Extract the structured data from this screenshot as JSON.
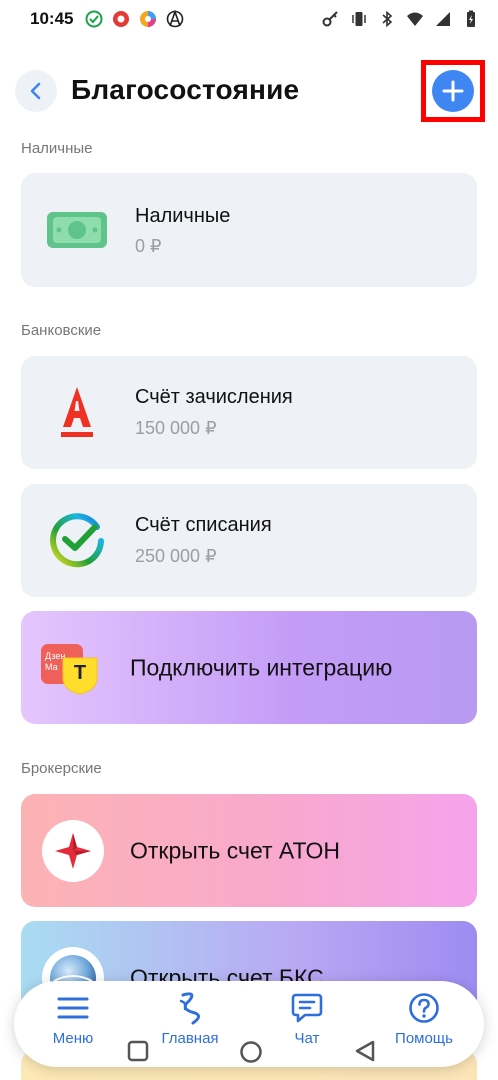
{
  "status_bar": {
    "time": "10:45",
    "left_icons": [
      "check-circle-icon",
      "red-app-icon",
      "colorful-app-icon",
      "anarchy-icon"
    ],
    "right_icons": [
      "key-icon",
      "vibrate-icon",
      "bluetooth-icon",
      "wifi-icon",
      "signal-icon",
      "battery-charging-icon"
    ]
  },
  "header": {
    "title": "Благосостояние",
    "back_icon": "chevron-left-icon",
    "add_icon": "plus-icon",
    "highlight_color": "#ff0000",
    "accent_color": "#3f86f3"
  },
  "sections": {
    "cash": {
      "label": "Наличные",
      "card": {
        "title": "Наличные",
        "amount": "0 ₽",
        "icon": "banknote-icon"
      }
    },
    "bank": {
      "label": "Банковские",
      "cards": [
        {
          "title": "Счёт зачисления",
          "amount": "150 000 ₽",
          "icon": "alfa-bank-logo-icon"
        },
        {
          "title": "Счёт списания",
          "amount": "250 000 ₽",
          "icon": "sber-logo-icon"
        }
      ],
      "integration": {
        "title": "Подключить интеграцию",
        "icon_text": "Дзен Ма",
        "icon": "dzen-money-tinkoff-icon",
        "badge_letter": "T"
      }
    },
    "broker": {
      "label": "Брокерские",
      "cards": [
        {
          "title": "Открыть счет АТОН",
          "icon": "aton-logo-icon"
        },
        {
          "title": "Открыть счет БКС",
          "icon": "bks-logo-icon"
        }
      ]
    }
  },
  "bottom_nav": {
    "items": [
      {
        "label": "Меню",
        "icon": "menu-icon"
      },
      {
        "label": "Главная",
        "icon": "home-swan-icon"
      },
      {
        "label": "Чат",
        "icon": "chat-icon"
      },
      {
        "label": "Помощь",
        "icon": "help-icon"
      }
    ],
    "color": "#2f6fdc"
  },
  "system_nav": [
    "recents-icon",
    "home-circle-icon",
    "back-triangle-icon"
  ]
}
